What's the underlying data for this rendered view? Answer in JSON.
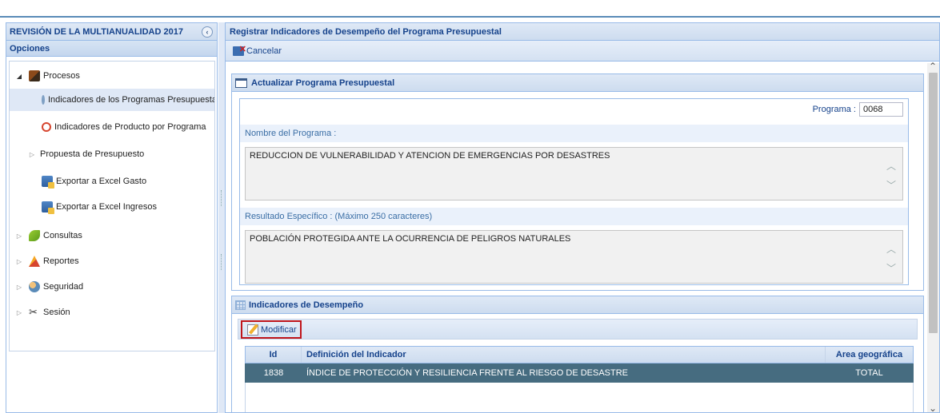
{
  "sidebar": {
    "title": "REVISIÓN DE LA MULTIANUALIDAD 2017",
    "collapse_icon": "collapse-left-icon",
    "options_label": "Opciones",
    "items": [
      {
        "label": "Procesos",
        "icon": "book-icon",
        "expanded": true
      },
      {
        "label": "Indicadores de los Programas Presupuestales",
        "icon": "info-icon",
        "selected": true
      },
      {
        "label": "Indicadores de Producto por Programa",
        "icon": "info-red-icon"
      },
      {
        "label": "Propuesta de Presupuesto",
        "icon": ""
      },
      {
        "label": "Exportar a Excel Gasto",
        "icon": "excel-icon"
      },
      {
        "label": "Exportar a Excel Ingresos",
        "icon": "excel-icon"
      },
      {
        "label": "Consultas",
        "icon": "leaf-icon"
      },
      {
        "label": "Reportes",
        "icon": "chart-icon"
      },
      {
        "label": "Seguridad",
        "icon": "users-icon"
      },
      {
        "label": "Sesión",
        "icon": "tools-icon"
      }
    ]
  },
  "main": {
    "title": "Registrar Indicadores de Desempeño del Programa Presupuestal",
    "cancel_label": "Cancelar",
    "update_section": {
      "title": "Actualizar Programa Presupuestal",
      "programa_label": "Programa :",
      "programa_value": "0068",
      "nombre_label": "Nombre del Programa :",
      "nombre_value": "REDUCCION DE VULNERABILIDAD Y ATENCION DE EMERGENCIAS POR DESASTRES",
      "resultado_label": "Resultado Específico : (Máximo 250 caracteres)",
      "resultado_value": "POBLACIÓN PROTEGIDA ANTE LA OCURRENCIA DE PELIGROS NATURALES"
    },
    "indicators_section": {
      "title": "Indicadores de Desempeño",
      "modify_label": "Modificar",
      "columns": {
        "id": "Id",
        "definition": "Definición del Indicador",
        "area": "Area geográfica"
      },
      "rows": [
        {
          "id": "1838",
          "definition": "ÍNDICE DE PROTECCIÓN Y RESILIENCIA FRENTE AL RIESGO DE DESASTRE",
          "area": "TOTAL"
        }
      ]
    }
  },
  "colors": {
    "header_text": "#15428b",
    "selected_row": "#466c80",
    "highlight_border": "#c0151b"
  }
}
